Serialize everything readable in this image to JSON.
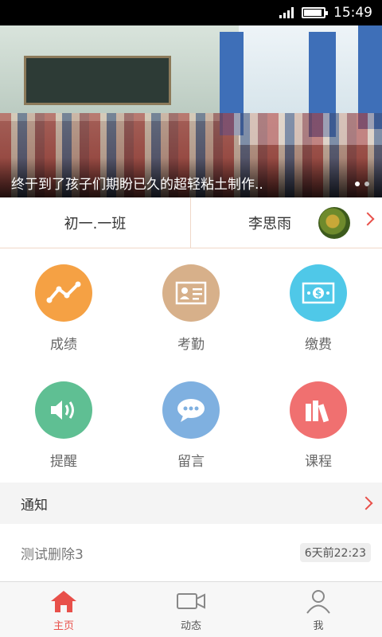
{
  "status_bar": {
    "time": "15:49"
  },
  "banner": {
    "caption": "终于到了孩子们期盼已久的超轻粘土制作..",
    "slide_count": 2,
    "active_slide": 1
  },
  "class_bar": {
    "class_name": "初一.一班",
    "student_name": "李思雨"
  },
  "features": [
    {
      "label": "成绩",
      "icon": "chart-line-icon",
      "color": "#f5a144"
    },
    {
      "label": "考勤",
      "icon": "id-card-icon",
      "color": "#d7b08a"
    },
    {
      "label": "缴费",
      "icon": "money-icon",
      "color": "#4fc8e8"
    },
    {
      "label": "提醒",
      "icon": "speaker-icon",
      "color": "#5fbf93"
    },
    {
      "label": "留言",
      "icon": "chat-bubble-icon",
      "color": "#7fb0e0"
    },
    {
      "label": "课程",
      "icon": "books-icon",
      "color": "#f07070"
    }
  ],
  "notice": {
    "title": "通知",
    "items": [
      {
        "text": "测试删除3",
        "time": "6天前22:23"
      }
    ]
  },
  "tabbar": {
    "tabs": [
      {
        "label": "主页",
        "icon": "home-icon",
        "active": true
      },
      {
        "label": "动态",
        "icon": "video-camera-icon",
        "active": false
      },
      {
        "label": "我",
        "icon": "person-icon",
        "active": false
      }
    ],
    "accent_color": "#e8504a"
  }
}
